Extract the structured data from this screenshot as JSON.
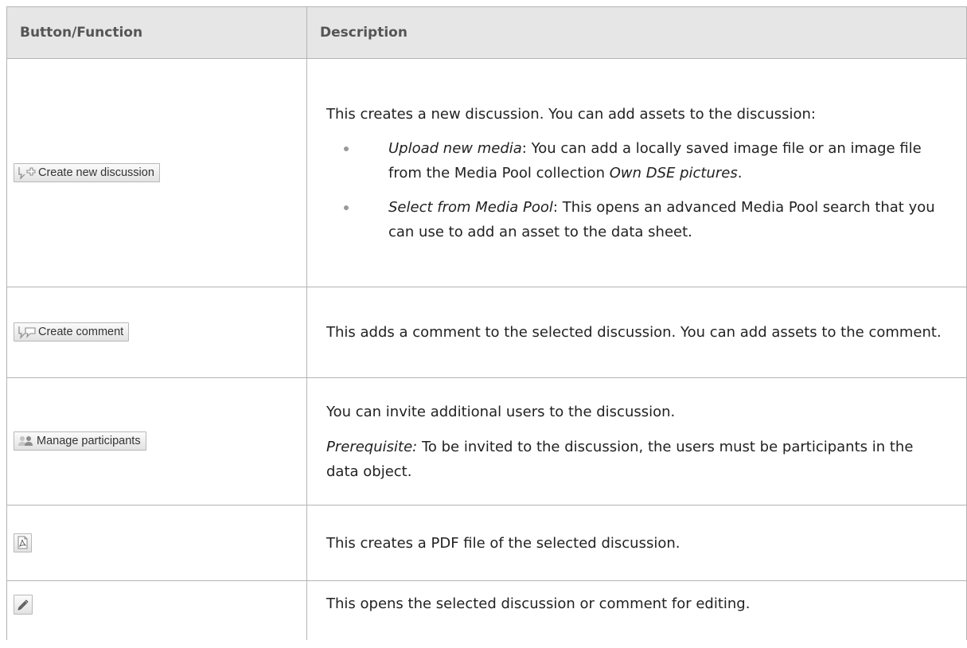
{
  "table": {
    "headers": [
      "Button/Function",
      "Description"
    ],
    "rows": [
      {
        "button": {
          "icon": "create-discussion-icon",
          "label": "Create new discussion"
        },
        "intro": "This creates a new discussion. You can add assets to the discussion:",
        "bullets": [
          {
            "term": "Upload new media",
            "text": ": You can add a locally saved image file or an image file from the Media Pool collection ",
            "emphasis": "Own DSE pictures",
            "end": "."
          },
          {
            "term": "Select from Media Pool",
            "text": ": This opens an advanced Media Pool search that you can use to add an asset to the data sheet."
          }
        ]
      },
      {
        "button": {
          "icon": "create-comment-icon",
          "label": "Create comment"
        },
        "description": "This adds a comment to the selected discussion. You can add assets to the comment."
      },
      {
        "button": {
          "icon": "participants-icon",
          "label": "Manage participants"
        },
        "description": "You can invite additional users to the discussion.",
        "prerequisite_label": "Prerequisite:",
        "prerequisite_text": " To be invited to the discussion, the users must be participants in the data object."
      },
      {
        "button": {
          "icon": "pdf-icon"
        },
        "description": "This creates a PDF file of the selected discussion."
      },
      {
        "button": {
          "icon": "pencil-icon"
        },
        "description": "This opens the selected discussion or comment for editing."
      }
    ]
  }
}
